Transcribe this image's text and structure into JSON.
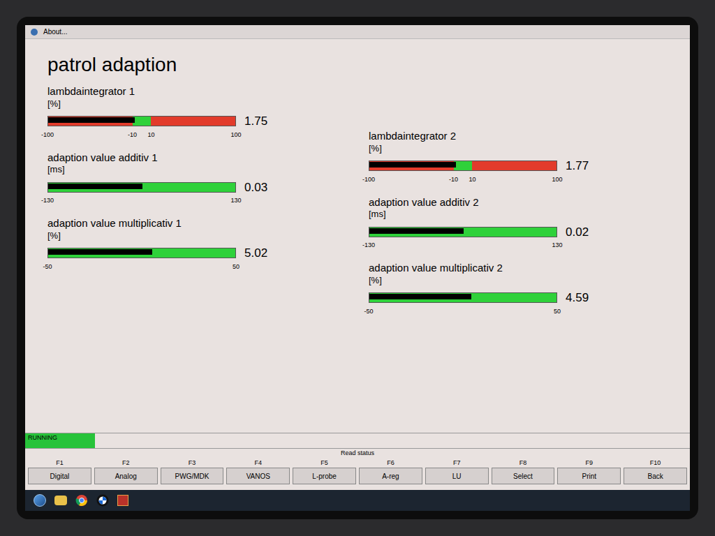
{
  "window": {
    "menu": "About..."
  },
  "title": "patrol adaption",
  "columns": [
    {
      "gauges": [
        {
          "label": "lambdaintegrator 1",
          "unit": "[%]",
          "value": "1.75",
          "level": 0.46,
          "zones": [
            {
              "share": 0.45,
              "color": "#e23b2b"
            },
            {
              "share": 0.1,
              "color": "#2fd13a"
            },
            {
              "share": 0.45,
              "color": "#e23b2b"
            }
          ],
          "ticks": [
            "-100",
            "-10",
            "10",
            "100"
          ]
        },
        {
          "label": "adaption value additiv 1",
          "unit": "[ms]",
          "value": "0.03",
          "level": 0.5,
          "zones": [
            {
              "share": 1,
              "color": "#2fd13a"
            }
          ],
          "ticks": [
            "-130",
            "130"
          ]
        },
        {
          "label": "adaption value multiplicativ 1",
          "unit": "[%]",
          "value": "5.02",
          "level": 0.55,
          "zones": [
            {
              "share": 1,
              "color": "#2fd13a"
            }
          ],
          "ticks": [
            "-50",
            "50"
          ]
        }
      ]
    },
    {
      "gauges": [
        {
          "label": "lambdaintegrator 2",
          "unit": "[%]",
          "value": "1.77",
          "level": 0.46,
          "zones": [
            {
              "share": 0.45,
              "color": "#e23b2b"
            },
            {
              "share": 0.1,
              "color": "#2fd13a"
            },
            {
              "share": 0.45,
              "color": "#e23b2b"
            }
          ],
          "ticks": [
            "-100",
            "-10",
            "10",
            "100"
          ]
        },
        {
          "label": "adaption value additiv 2",
          "unit": "[ms]",
          "value": "0.02",
          "level": 0.5,
          "zones": [
            {
              "share": 1,
              "color": "#2fd13a"
            }
          ],
          "ticks": [
            "-130",
            "130"
          ]
        },
        {
          "label": "adaption value multiplicativ 2",
          "unit": "[%]",
          "value": "4.59",
          "level": 0.54,
          "zones": [
            {
              "share": 1,
              "color": "#2fd13a"
            }
          ],
          "ticks": [
            "-50",
            "50"
          ]
        }
      ]
    }
  ],
  "status": {
    "text": "RUNNING"
  },
  "group_label": "Read status",
  "function_keys": [
    {
      "key": "F1",
      "label": "Digital"
    },
    {
      "key": "F2",
      "label": "Analog"
    },
    {
      "key": "F3",
      "label": "PWG/MDK"
    },
    {
      "key": "F4",
      "label": "VANOS"
    },
    {
      "key": "F5",
      "label": "L-probe"
    },
    {
      "key": "F6",
      "label": "A-reg"
    },
    {
      "key": "F7",
      "label": "LU"
    },
    {
      "key": "F8",
      "label": "Select"
    },
    {
      "key": "F9",
      "label": "Print"
    },
    {
      "key": "F10",
      "label": "Back"
    }
  ]
}
